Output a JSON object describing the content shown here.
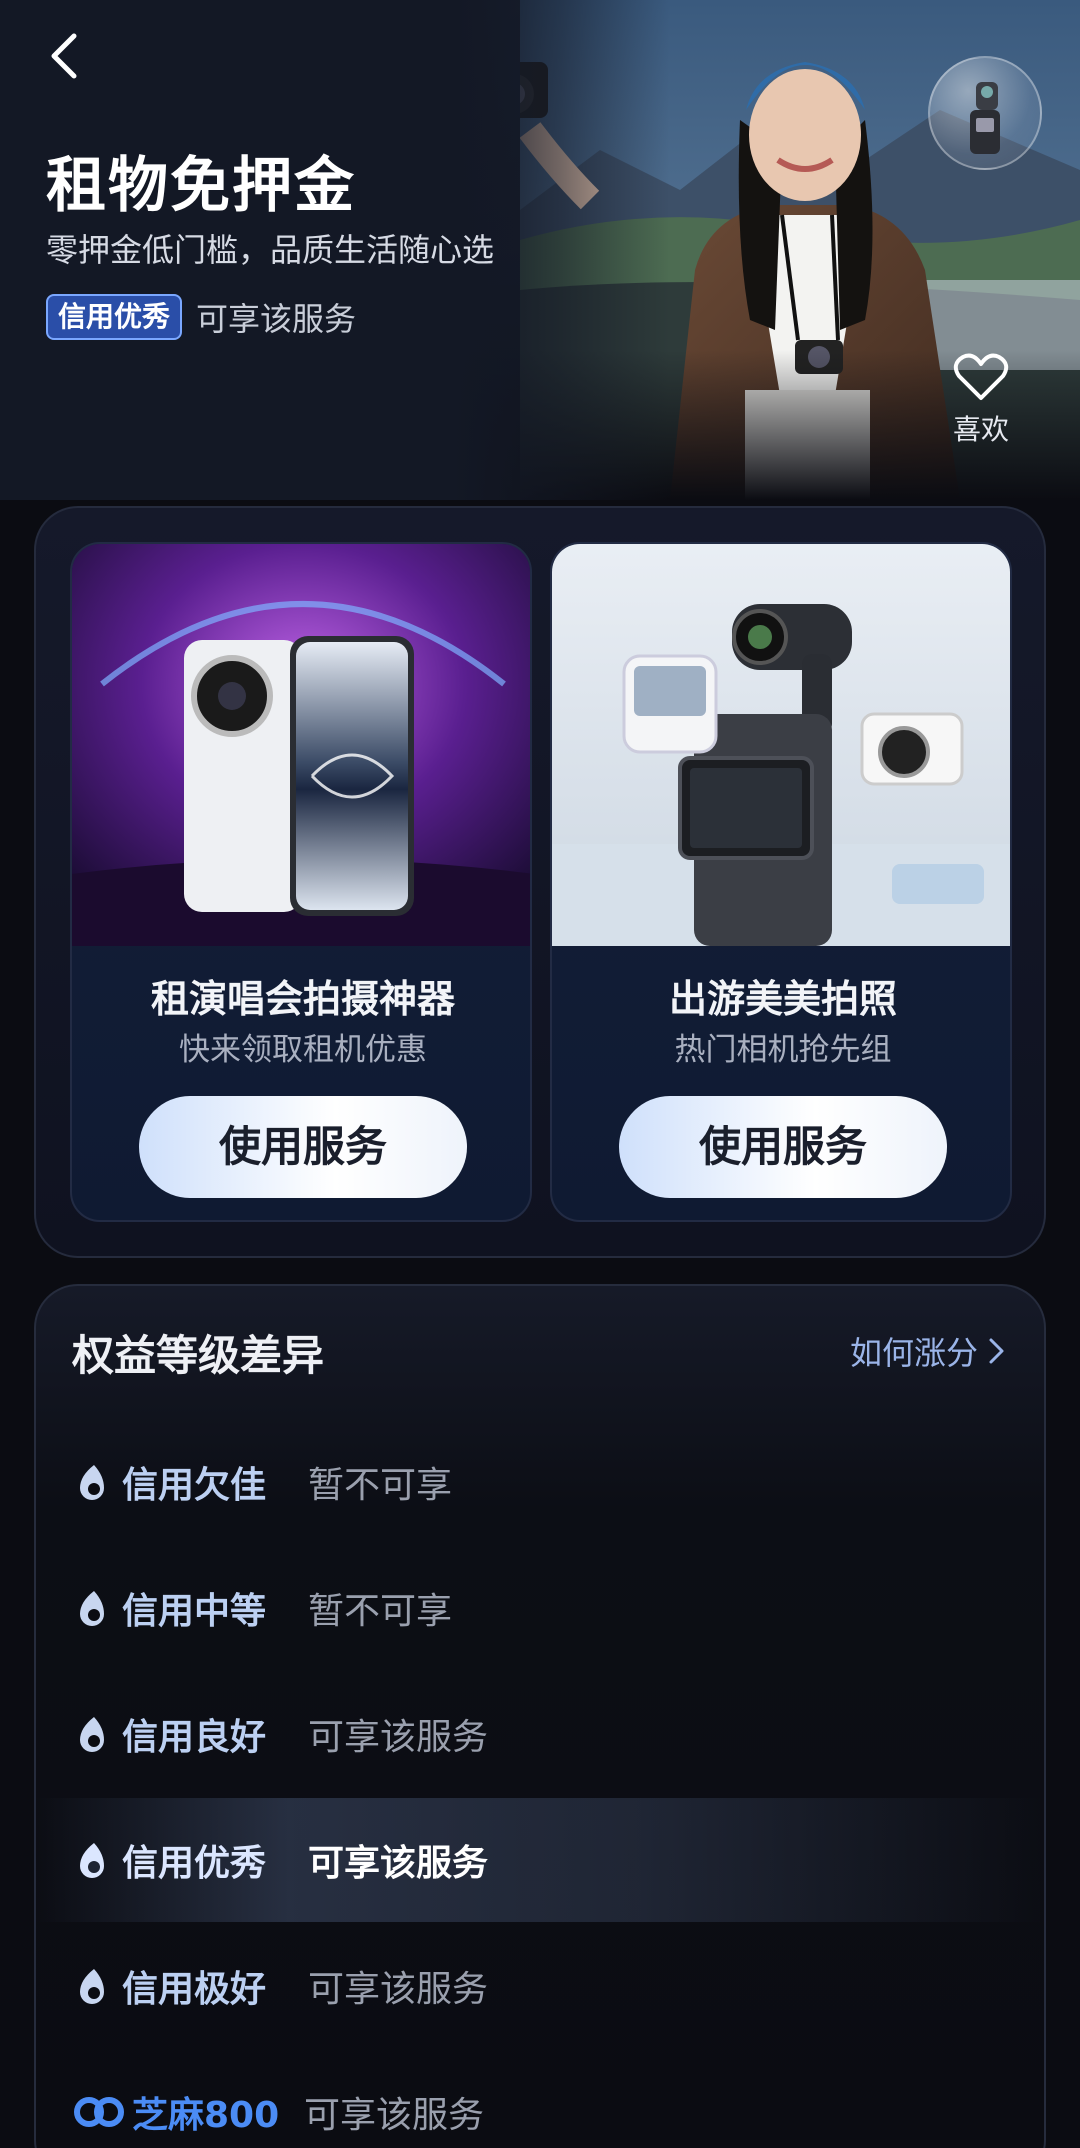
{
  "hero": {
    "title": "租物免押金",
    "subtitle": "零押金低门槛，品质生活随心选",
    "badge": "信用优秀",
    "badge_text": "可享该服务",
    "like_label": "喜欢"
  },
  "cards": [
    {
      "title": "租演唱会拍摄神器",
      "subtitle": "快来领取租机优惠",
      "button": "使用服务",
      "image": "vivo-phone-concert"
    },
    {
      "title": "出游美美拍照",
      "subtitle": "热门相机抢先组",
      "button": "使用服务",
      "image": "pocket-camera-gimbal"
    }
  ],
  "tiers": {
    "heading": "权益等级差异",
    "link": "如何涨分",
    "rows": [
      {
        "name": "信用欠佳",
        "status": "暂不可享",
        "icon": "flame-icon"
      },
      {
        "name": "信用中等",
        "status": "暂不可享",
        "icon": "flame-icon"
      },
      {
        "name": "信用良好",
        "status": "可享该服务",
        "icon": "flame-icon"
      },
      {
        "name": "信用优秀",
        "status": "可享该服务",
        "icon": "flame-icon",
        "highlight": true
      },
      {
        "name": "信用极好",
        "status": "可享该服务",
        "icon": "flame-icon"
      },
      {
        "name": "芝麻800",
        "status": "可享该服务",
        "icon": "zhima-icon"
      }
    ]
  },
  "colors": {
    "accent": "#2a4ea8",
    "link": "#9ab4e8",
    "zhima": "#4b8cf5",
    "background": "#0b0c12"
  }
}
